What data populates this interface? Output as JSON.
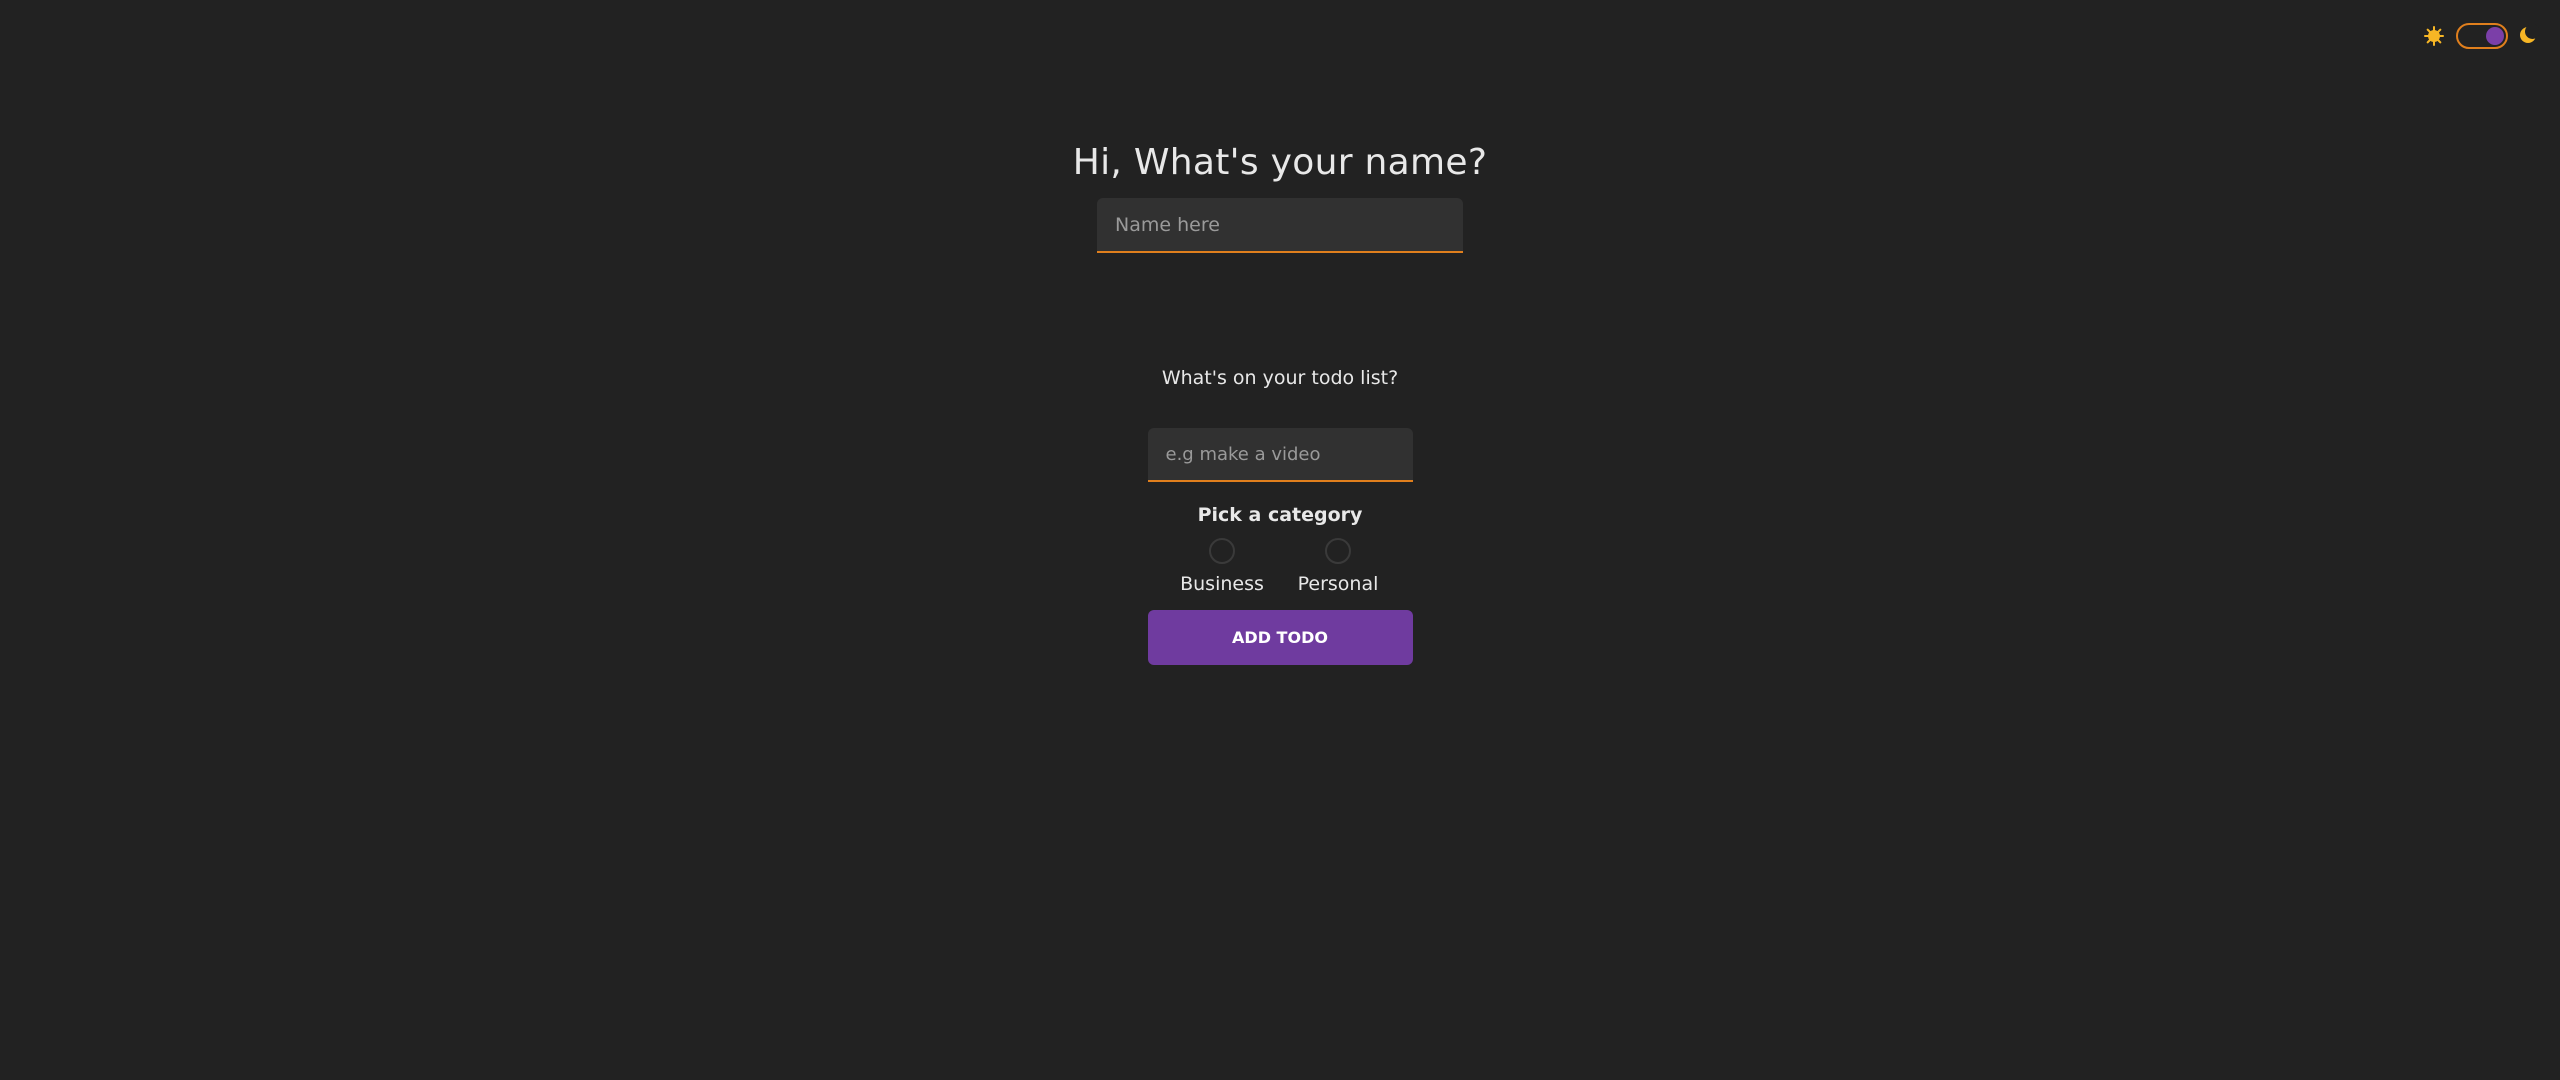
{
  "theme_toggle": {
    "light_icon": "sun-icon",
    "dark_icon": "moon-icon",
    "state": "dark",
    "colors": {
      "border": "#e07f1d",
      "knob": "#7b3fa8",
      "icons": "#f7b625"
    }
  },
  "greeting": {
    "title": "Hi, What's your name?",
    "name_placeholder": "Name here",
    "name_value": ""
  },
  "create_todo": {
    "question": "What's on your todo list?",
    "todo_placeholder": "e.g make a video",
    "todo_value": "",
    "category_label": "Pick a category",
    "categories": [
      {
        "label": "Business",
        "selected": false
      },
      {
        "label": "Personal",
        "selected": false
      }
    ],
    "add_button_label": "ADD TODO"
  },
  "colors": {
    "background": "#222222",
    "input_background": "#313131",
    "accent_underline": "#e07f1d",
    "button_primary": "#6f3b9f"
  }
}
